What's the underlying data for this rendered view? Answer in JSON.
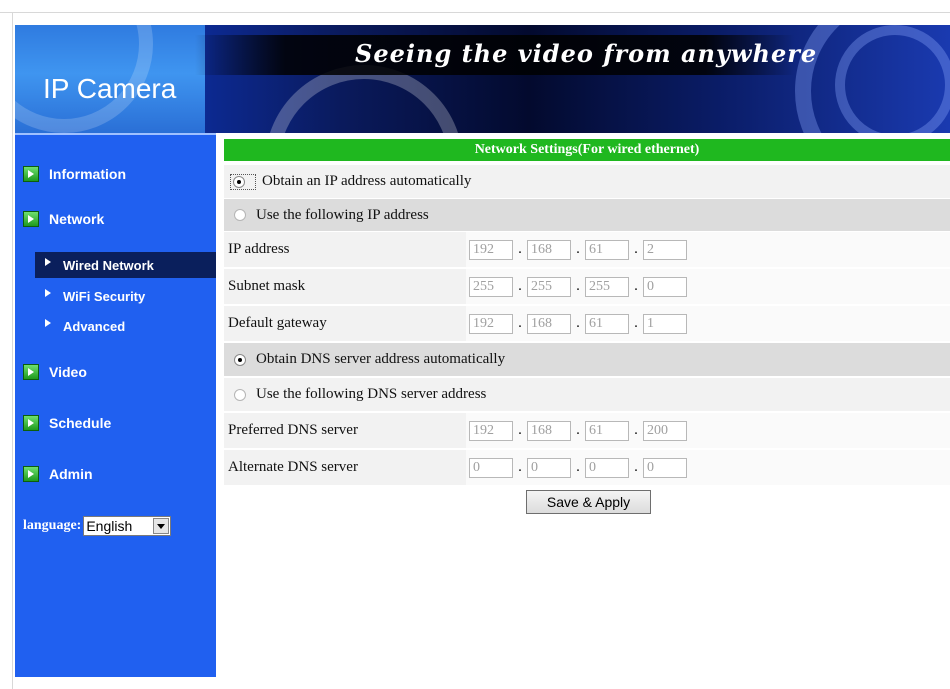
{
  "banner": {
    "product": "IP Camera",
    "slogan": "Seeing the video from anywhere"
  },
  "sidebar": {
    "items": [
      {
        "label": "Information"
      },
      {
        "label": "Network"
      },
      {
        "label": "Video"
      },
      {
        "label": "Schedule"
      },
      {
        "label": "Admin"
      }
    ],
    "network_sub": [
      {
        "label": "Wired Network",
        "active": true
      },
      {
        "label": "WiFi Security",
        "active": false
      },
      {
        "label": "Advanced",
        "active": false
      }
    ],
    "language_label": "language:",
    "language_value": "English"
  },
  "panel": {
    "title": "Network Settings(For wired ethernet)",
    "ip_auto": "Obtain an IP address automatically",
    "ip_manual": "Use the following IP address",
    "ip_address_label": "IP address",
    "subnet_label": "Subnet mask",
    "gateway_label": "Default gateway",
    "dns_auto": "Obtain DNS server address automatically",
    "dns_manual": "Use the following DNS server address",
    "dns_preferred_label": "Preferred DNS server",
    "dns_alternate_label": "Alternate DNS server",
    "ip_address": [
      "192",
      "168",
      "61",
      "2"
    ],
    "subnet_mask": [
      "255",
      "255",
      "255",
      "0"
    ],
    "gateway": [
      "192",
      "168",
      "61",
      "1"
    ],
    "dns_preferred": [
      "192",
      "168",
      "61",
      "200"
    ],
    "dns_alternate": [
      "0",
      "0",
      "0",
      "0"
    ],
    "ip_mode": "automatic",
    "dns_mode": "automatic",
    "save_label": "Save & Apply"
  },
  "colors": {
    "sidebar": "#2060f0",
    "header_green": "#1fb81f",
    "active_sub": "#0a1f5c"
  }
}
